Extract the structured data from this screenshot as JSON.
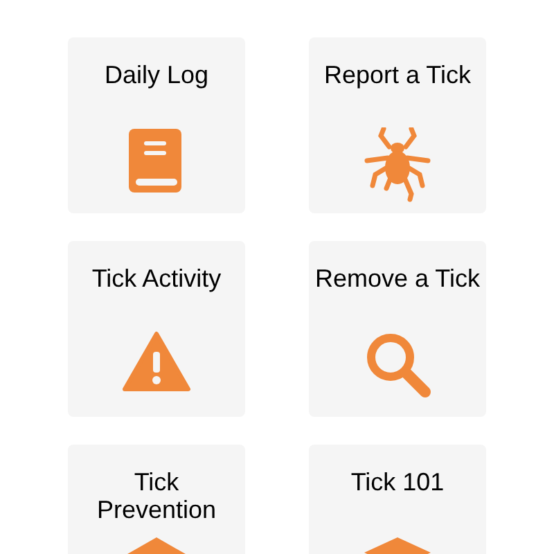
{
  "tiles": [
    {
      "label": "Daily Log"
    },
    {
      "label": "Report a Tick"
    },
    {
      "label": "Tick Activity"
    },
    {
      "label": "Remove a Tick"
    },
    {
      "label": "Tick Prevention"
    },
    {
      "label": "Tick 101"
    }
  ]
}
